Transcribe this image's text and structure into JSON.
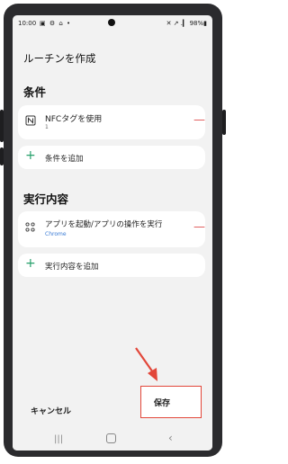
{
  "status_bar": {
    "time": "10:00",
    "left_icons": "▣ ⚙ ⌂ •",
    "right_icons": "✕ ↗ .▎ 98%▮"
  },
  "page": {
    "title": "ルーチンを作成"
  },
  "conditions": {
    "section_title": "条件",
    "item": {
      "icon": "nfc-icon",
      "title": "NFCタグを使用",
      "subtitle": "1"
    },
    "add_label": "条件を追加"
  },
  "actions": {
    "section_title": "実行内容",
    "item": {
      "icon": "apps-grid-icon",
      "title": "アプリを起動/アプリの操作を実行",
      "subtitle": "Chrome"
    },
    "add_label": "実行内容を追加"
  },
  "footer": {
    "cancel_label": "キャンセル",
    "save_label": "保存"
  },
  "colors": {
    "accent_red": "#e05a5a",
    "accent_green": "#27a06b",
    "link_blue": "#3a7bd5",
    "highlight_border": "#e2473a"
  }
}
